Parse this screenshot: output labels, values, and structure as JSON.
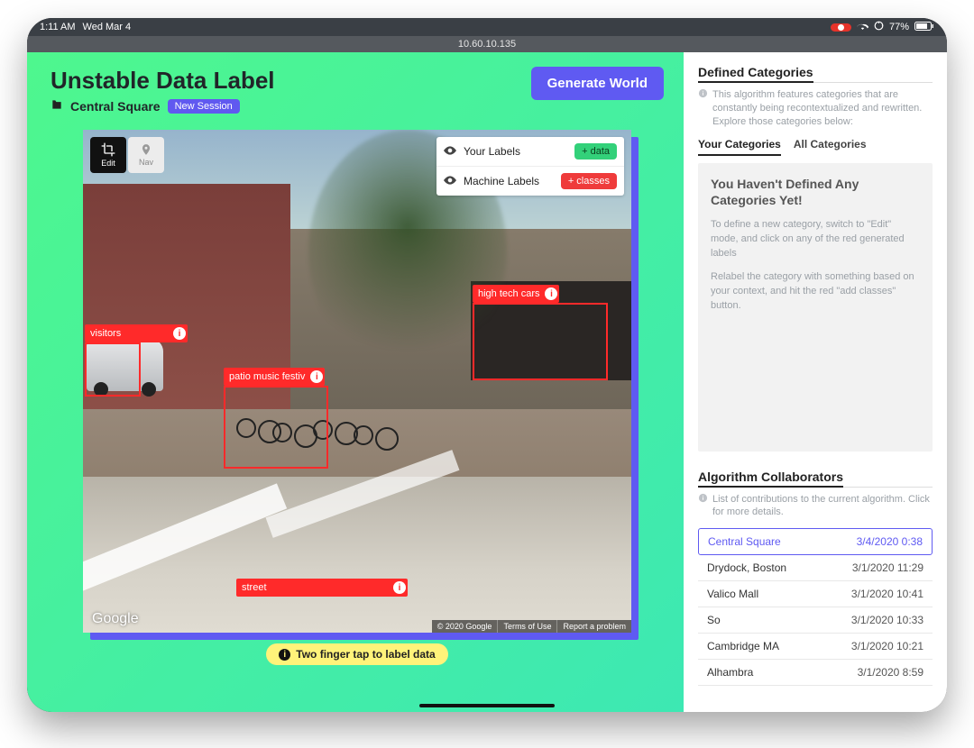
{
  "status": {
    "time": "1:11 AM",
    "date": "Wed Mar 4",
    "battery": "77%"
  },
  "url": "10.60.10.135",
  "header": {
    "title": "Unstable Data Label",
    "location": "Central Square",
    "session_badge": "New Session",
    "generate_btn": "Generate World"
  },
  "map_tools": {
    "edit": "Edit",
    "nav": "Nav"
  },
  "label_panel": {
    "row1": "Your Labels",
    "row1_btn": "+ data",
    "row2": "Machine Labels",
    "row2_btn": "+ classes"
  },
  "detections": {
    "visitors": "visitors",
    "patio": "patio music festiv",
    "cars": "high tech cars",
    "street": "street"
  },
  "attribution": {
    "copyright": "© 2020 Google",
    "terms": "Terms of Use",
    "report": "Report a problem",
    "logo": "Google"
  },
  "hint": "Two finger tap to label data",
  "side": {
    "defined_title": "Defined Categories",
    "defined_info": "This algorithm features categories that are constantly being recontextualized and rewritten. Explore those categories below:",
    "tab_your": "Your Categories",
    "tab_all": "All Categories",
    "empty_title": "You Haven't Defined Any Categories Yet!",
    "empty_p1": "To define a new category, switch to \"Edit\" mode, and click on any of the red generated labels",
    "empty_p2": "Relabel the category with something based on your context, and hit the red \"add classes\" button.",
    "collab_title": "Algorithm Collaborators",
    "collab_info": "List of contributions to the current algorithm. Click for more details.",
    "collab": [
      {
        "name": "Central Square",
        "date": "3/4/2020 0:38"
      },
      {
        "name": "Drydock, Boston",
        "date": "3/1/2020 11:29"
      },
      {
        "name": "Valico Mall",
        "date": "3/1/2020 10:41"
      },
      {
        "name": "So",
        "date": "3/1/2020 10:33"
      },
      {
        "name": "Cambridge MA",
        "date": "3/1/2020 10:21"
      },
      {
        "name": "Alhambra",
        "date": "3/1/2020 8:59"
      }
    ]
  }
}
